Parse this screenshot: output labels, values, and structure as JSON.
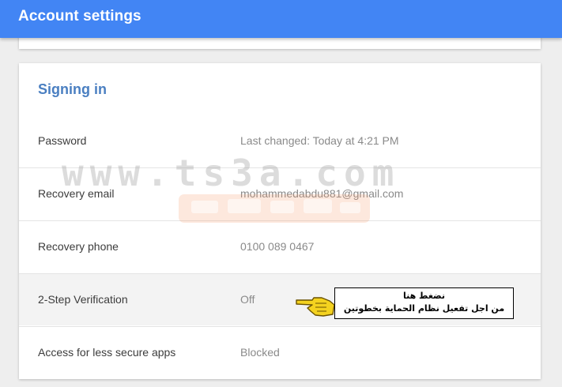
{
  "header": {
    "title": "Account settings"
  },
  "section": {
    "title": "Signing in"
  },
  "rows": [
    {
      "label": "Password",
      "value": "Last changed: Today at 4:21 PM"
    },
    {
      "label": "Recovery email",
      "value": "mohammedabdu881@gmail.com"
    },
    {
      "label": "Recovery phone",
      "value": "0100 089 0467"
    },
    {
      "label": "2-Step Verification",
      "value": "Off"
    },
    {
      "label": "Access for less secure apps",
      "value": "Blocked"
    }
  ],
  "watermark": {
    "text": "www.ts3a.com"
  },
  "annotation": {
    "line1": "نضغط هنا",
    "line2": "من اجل تفعيل نظام الحماية بخطوتين",
    "icon": "pointing-hand-icon"
  },
  "colors": {
    "header_bg": "#4285f4",
    "section_title": "#4a7fc1",
    "page_bg": "#eeeeee",
    "highlight_row": "#f3f3f3"
  }
}
